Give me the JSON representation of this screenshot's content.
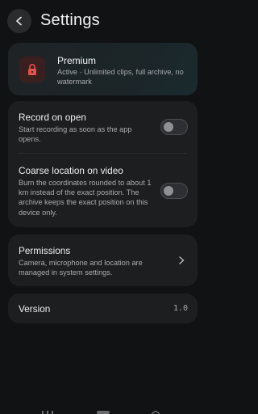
{
  "header": {
    "title": "Settings"
  },
  "premium": {
    "title": "Premium",
    "description": "Active · Unlimited clips, full archive, no watermark",
    "accent_color": "#e5534b"
  },
  "toggles": [
    {
      "title": "Record on open",
      "description": "Start recording as soon as the app opens.",
      "enabled": false
    },
    {
      "title": "Coarse location on video",
      "description": "Burn the coordinates rounded to about 1 km instead of the exact position. The archive keeps the exact position on this device only.",
      "enabled": false
    }
  ],
  "permissions": {
    "title": "Permissions",
    "description": "Camera, microphone and location are managed in system settings."
  },
  "version": {
    "label": "Version",
    "value": "1.0"
  },
  "icons": {
    "back": "back-arrow-icon",
    "lock": "lock-icon",
    "chevron": "chevron-right-icon"
  }
}
